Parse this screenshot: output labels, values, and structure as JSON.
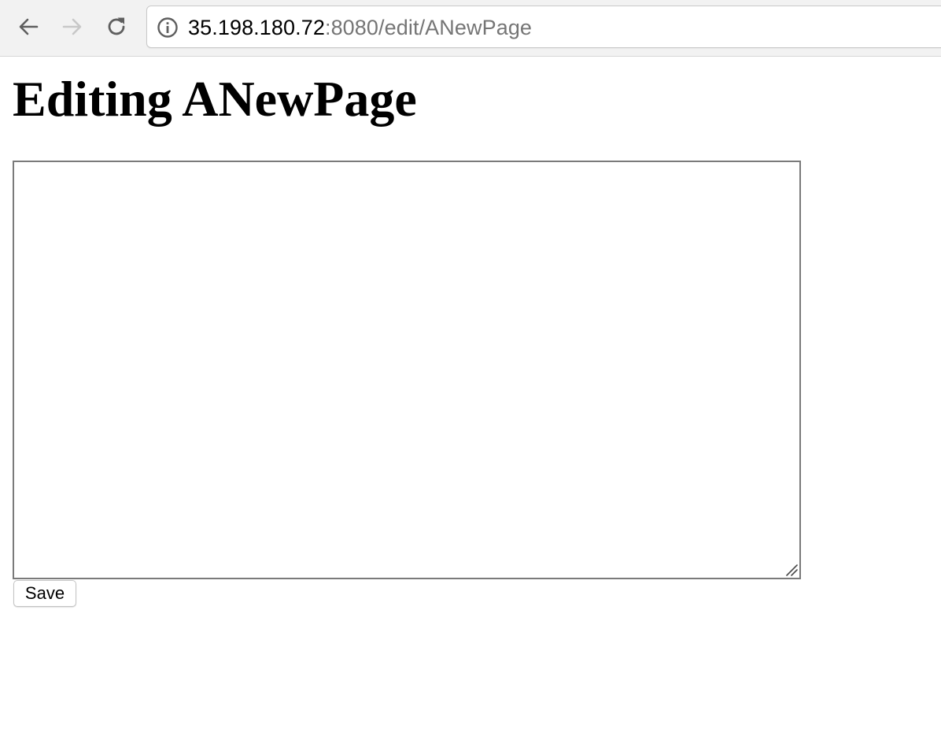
{
  "browser": {
    "url_host": "35.198.180.72",
    "url_rest": ":8080/edit/ANewPage",
    "icons": {
      "back": "arrow-left-icon",
      "forward": "arrow-right-icon",
      "reload": "reload-icon",
      "info": "info-circle-icon"
    },
    "colors": {
      "toolbar_bg": "#f2f2f2",
      "url_host": "#000000",
      "url_rest": "#757575",
      "forward_disabled": "#c8c8c8"
    },
    "forward_enabled": false
  },
  "page": {
    "title": "Editing ANewPage",
    "editor": {
      "value": "",
      "placeholder": ""
    },
    "save_label": "Save"
  }
}
